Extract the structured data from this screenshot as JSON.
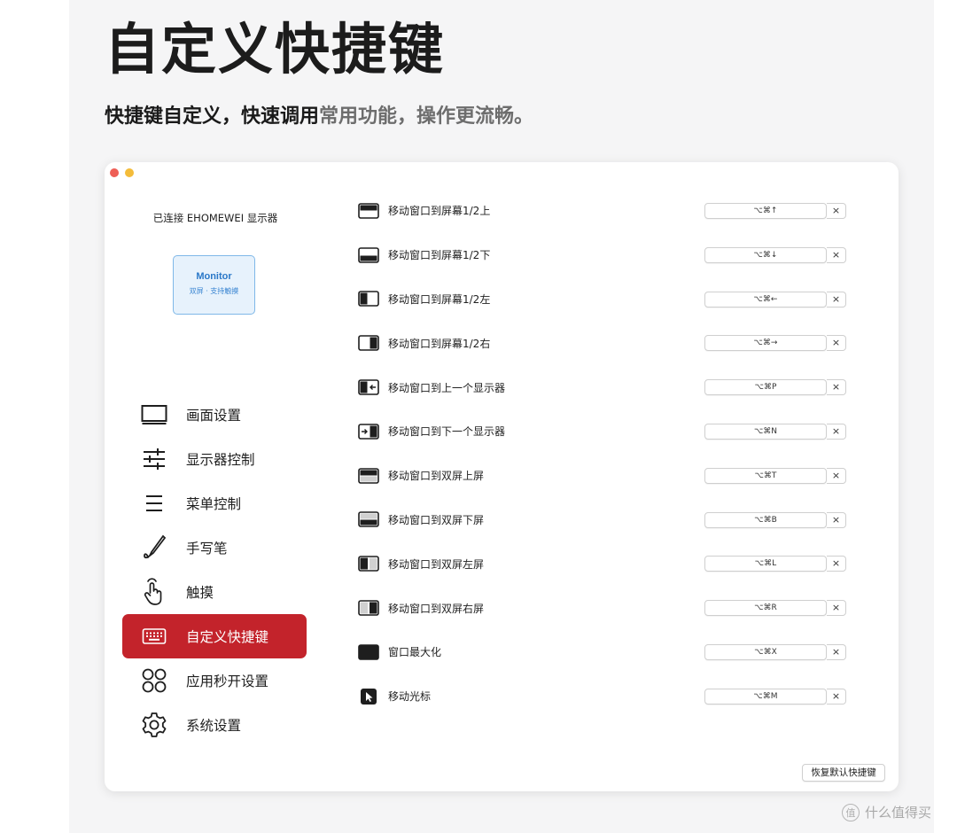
{
  "hero": {
    "title": "自定义快捷键",
    "subtitle_dark": "快捷键自定义，快速调用",
    "subtitle_gray": "常用功能，操作更流畅。"
  },
  "sidebar": {
    "connection_label": "已连接 EHOMEWEI 显示器",
    "monitor_card": {
      "title": "Monitor",
      "subtitle": "双屏 · 支持触摸"
    },
    "items": [
      {
        "label": "画面设置",
        "icon": "monitor-icon"
      },
      {
        "label": "显示器控制",
        "icon": "sliders-icon"
      },
      {
        "label": "菜单控制",
        "icon": "menu-icon"
      },
      {
        "label": "手写笔",
        "icon": "pen-icon"
      },
      {
        "label": "触摸",
        "icon": "touch-hand-icon"
      },
      {
        "label": "自定义快捷键",
        "icon": "keyboard-icon",
        "active": true
      },
      {
        "label": "应用秒开设置",
        "icon": "apps-grid-icon"
      },
      {
        "label": "系统设置",
        "icon": "gear-icon"
      }
    ]
  },
  "shortcuts": [
    {
      "label": "移动窗口到屏幕1/2上",
      "keys": "⌥⌘↑",
      "icon": "window-top-half-icon"
    },
    {
      "label": "移动窗口到屏幕1/2下",
      "keys": "⌥⌘↓",
      "icon": "window-bottom-half-icon"
    },
    {
      "label": "移动窗口到屏幕1/2左",
      "keys": "⌥⌘←",
      "icon": "window-left-half-icon"
    },
    {
      "label": "移动窗口到屏幕1/2右",
      "keys": "⌥⌘→",
      "icon": "window-right-half-icon"
    },
    {
      "label": "移动窗口到上一个显示器",
      "keys": "⌥⌘P",
      "icon": "window-prev-display-icon"
    },
    {
      "label": "移动窗口到下一个显示器",
      "keys": "⌥⌘N",
      "icon": "window-next-display-icon"
    },
    {
      "label": "移动窗口到双屏上屏",
      "keys": "⌥⌘T",
      "icon": "dual-top-screen-icon"
    },
    {
      "label": "移动窗口到双屏下屏",
      "keys": "⌥⌘B",
      "icon": "dual-bottom-screen-icon"
    },
    {
      "label": "移动窗口到双屏左屏",
      "keys": "⌥⌘L",
      "icon": "dual-left-screen-icon"
    },
    {
      "label": "移动窗口到双屏右屏",
      "keys": "⌥⌘R",
      "icon": "dual-right-screen-icon"
    },
    {
      "label": "窗口最大化",
      "keys": "⌥⌘X",
      "icon": "window-maximize-icon"
    },
    {
      "label": "移动光标",
      "keys": "⌥⌘M",
      "icon": "cursor-icon"
    }
  ],
  "clear_glyph": "×",
  "reset_button": "恢复默认快捷键",
  "watermark": {
    "logo": "值",
    "text": "什么值得买"
  },
  "colors": {
    "accent": "#c3232b",
    "monitor_card_border": "#7fb8e8",
    "monitor_card_bg": "#e7f2fc",
    "traffic_red": "#ee5e56",
    "traffic_yellow": "#f4bc3a"
  }
}
